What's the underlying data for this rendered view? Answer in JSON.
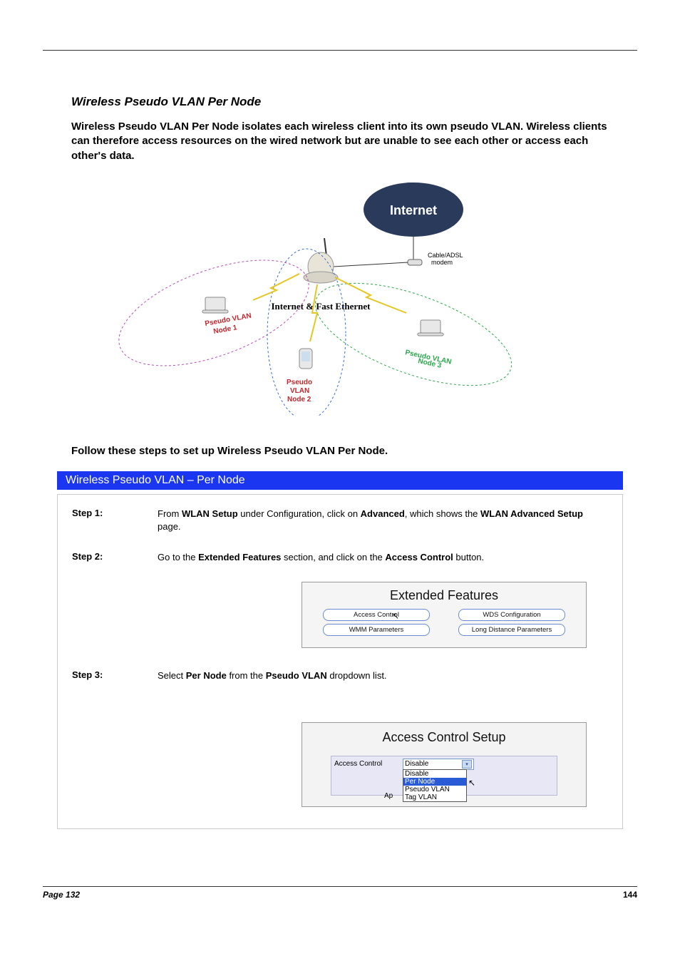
{
  "heading": "Wireless Pseudo VLAN Per Node",
  "body_intro": "Wireless Pseudo VLAN Per Node isolates each wireless client into its own pseudo VLAN. Wireless clients can therefore access resources on the wired network but are unable to see each other or access each other's data.",
  "diagram": {
    "internet_label": "Internet",
    "modem_label_1": "Cable/ADSL",
    "modem_label_2": "modem",
    "center_label": "Internet & Fast Ethernet",
    "node1_a": "Pseudo VLAN",
    "node1_b": "Node 1",
    "node2_a": "Pseudo",
    "node2_b": "VLAN",
    "node2_c": "Node 2",
    "node3_a": "Pseudo VLAN",
    "node3_b": "Node 3"
  },
  "follow_text": "Follow these steps to set up Wireless Pseudo VLAN Per Node.",
  "blue_bar": "Wireless Pseudo VLAN – Per Node",
  "step1": {
    "label": "Step 1:",
    "text_a": "From ",
    "text_b": "WLAN Setup",
    "text_c": " under Configuration, click on ",
    "text_d": "Advanced",
    "text_e": ", which shows the ",
    "text_f": "WLAN Advanced Setup",
    "text_g": " page."
  },
  "step2": {
    "label": "Step 2:",
    "text_a": "Go to the ",
    "text_b": "Extended Features",
    "text_c": " section, and click on the ",
    "text_d": "Access Control ",
    "text_e": "button."
  },
  "ext": {
    "title": "Extended Features",
    "btn1": "Access Control",
    "btn2": "WDS Configuration",
    "btn3": "WMM Parameters",
    "btn4": "Long Distance Parameters"
  },
  "step3": {
    "label": "Step 3:",
    "text_a": "Select ",
    "text_b": "Per Node",
    "text_c": " from the ",
    "text_d": "Pseudo VLAN",
    "text_e": " dropdown list."
  },
  "acs": {
    "title": "Access Control Setup",
    "key": "Access Control",
    "selected": "Disable",
    "options": [
      "Disable",
      "Per Node",
      "Pseudo VLAN",
      "Tag VLAN"
    ],
    "apply_prefix": "Ap"
  },
  "footer": "Page 132",
  "pagenum": "144"
}
